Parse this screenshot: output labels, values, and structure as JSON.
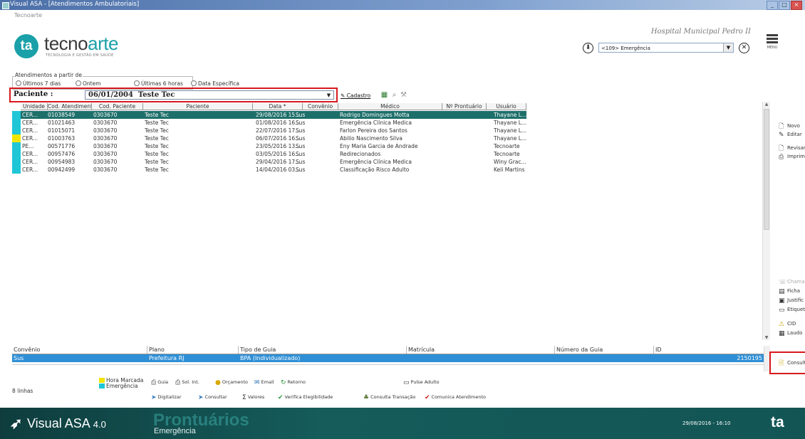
{
  "window": {
    "title": "Visual ASA - [Atendimentos Ambulatoriais]",
    "company": "Tecnoarte"
  },
  "brand": {
    "logo_mark": "ta",
    "name_a": "tecno",
    "name_b": "arte",
    "tagline": "TECNOLOGIA E GESTÃO EM SAÚDE"
  },
  "hospital": "Hospital Municipal Pedro II",
  "unit": {
    "value": "<109> Emergência"
  },
  "menu_label": "MENU",
  "filter": {
    "legend": "Atendimentos a partir de",
    "options": [
      "Últimos 7 dias",
      "Ontem",
      "Últimas 6 horas",
      "Data Específica"
    ]
  },
  "patient": {
    "label": "Paciente :",
    "value": "06/01/2004  Teste Tec",
    "cadastro": "Cadastro"
  },
  "grid": {
    "columns": [
      "Unidade",
      "Cod. Atendimento",
      "Cod. Paciente",
      "Paciente",
      "Data *",
      "Convênio",
      "Médico",
      "Nº Prontuário",
      "Usuário"
    ],
    "rows": [
      {
        "flag": "#1fc6d6",
        "unidade": "CER...",
        "cod_at": "01038549",
        "cod_pac": "0303670",
        "paciente": "Teste Tec",
        "data": "29/08/2016 15...",
        "convenio": "Sus",
        "medico": "Rodrigo Domingues Motta",
        "pront": "",
        "usuario": "Thayane L..."
      },
      {
        "flag": "#1fc6d6",
        "unidade": "CER...",
        "cod_at": "01021463",
        "cod_pac": "0303670",
        "paciente": "Teste Tec",
        "data": "01/08/2016 16...",
        "convenio": "Sus",
        "medico": "Emergência Clínica Medica",
        "pront": "",
        "usuario": "Thayane L..."
      },
      {
        "flag": "#1fc6d6",
        "unidade": "CER...",
        "cod_at": "01015071",
        "cod_pac": "0303670",
        "paciente": "Teste Tec",
        "data": "22/07/2016 17...",
        "convenio": "Sus",
        "medico": "Farlon Pereira dos Santos",
        "pront": "",
        "usuario": "Thayane L..."
      },
      {
        "flag": "#f2e600",
        "unidade": "CER...",
        "cod_at": "01003763",
        "cod_pac": "0303670",
        "paciente": "Teste Tec",
        "data": "06/07/2016 16...",
        "convenio": "Sus",
        "medico": "Abilio Nascimento Silva",
        "pront": "",
        "usuario": "Thayane L..."
      },
      {
        "flag": "#1fc6d6",
        "unidade": "PE...",
        "cod_at": "00571776",
        "cod_pac": "0303670",
        "paciente": "Teste Tec",
        "data": "23/05/2016 13...",
        "convenio": "Sus",
        "medico": "Eny Maria Garcia de Andrade",
        "pront": "",
        "usuario": "Tecnoarte"
      },
      {
        "flag": "#1fc6d6",
        "unidade": "CER...",
        "cod_at": "00957476",
        "cod_pac": "0303670",
        "paciente": "Teste Tec",
        "data": "03/05/2016 16...",
        "convenio": "Sus",
        "medico": "Redirecionados",
        "pront": "",
        "usuario": "Tecnoarte"
      },
      {
        "flag": "#1fc6d6",
        "unidade": "CER...",
        "cod_at": "00954983",
        "cod_pac": "0303670",
        "paciente": "Teste Tec",
        "data": "29/04/2016 17...",
        "convenio": "Sus",
        "medico": "Emergência Clínica Medica",
        "pront": "",
        "usuario": "Winy Grac..."
      },
      {
        "flag": "#1fc6d6",
        "unidade": "CER...",
        "cod_at": "00942499",
        "cod_pac": "0303670",
        "paciente": "Teste Tec",
        "data": "14/04/2016 03...",
        "convenio": "Sus",
        "medico": "Classificação Risco Adulto",
        "pront": "",
        "usuario": "Keli Martins"
      }
    ]
  },
  "actions_top": [
    "Novo",
    "Editar",
    "Revisar",
    "Imprimir"
  ],
  "actions_mid": [
    "Chamar",
    "Ficha",
    "Justific",
    "Etiqueta",
    "CID",
    "Laudo"
  ],
  "actions_bottom": [
    "Consulta"
  ],
  "guide_grid": {
    "columns": [
      "Convênio",
      "Plano",
      "Tipo de Guia",
      "Matrícula",
      "Número da Guia",
      "ID"
    ],
    "row": {
      "convenio": "Sus",
      "plano": "Prefeitura RJ",
      "tipo": "BPA (Individualizado)",
      "matricula": "",
      "numero": "",
      "id": "2150195"
    }
  },
  "lines_count": "8 linhas",
  "legend": {
    "hora_marcada": "Hora Marcada",
    "emergencia": "Emergência",
    "hm_color": "#f2e600",
    "em_color": "#1fc6d6"
  },
  "footer_buttons_row1": [
    "Guia",
    "Sol. Int.",
    "Orçamento",
    "Email",
    "Retorno",
    "Pulse Adulto"
  ],
  "footer_buttons_row2": [
    "Digitalizar",
    "Consultar",
    "Valores",
    "Verifica Elegibilidade",
    "Consulta Transação",
    "Comunica Atendimento"
  ],
  "bottom": {
    "product": "Visual ASA",
    "version": "4.0",
    "module": "Prontuários",
    "submodule": "Emergência",
    "datetime": "29/08/2016 - 16:10",
    "mark": "ta"
  }
}
